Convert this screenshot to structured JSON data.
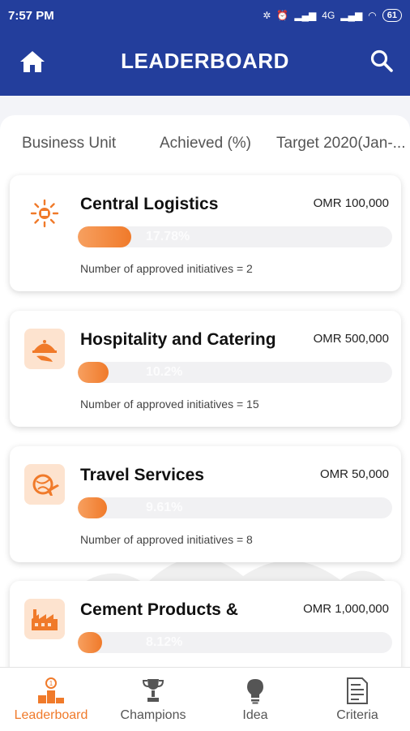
{
  "status": {
    "time": "7:57 PM",
    "network": "4G",
    "battery": "61"
  },
  "header": {
    "title": "LEADERBOARD"
  },
  "columns": [
    "Business Unit",
    "Achieved (%)",
    "Target 2020(Jan-..."
  ],
  "units": [
    {
      "name": "Central Logistics",
      "target": "OMR 100,000",
      "achieved_label": "17.78%",
      "achieved_fraction": 0.1778,
      "count_text": "Number of approved initiatives = 2",
      "icon": "logistics-sun-icon"
    },
    {
      "name": "Hospitality and Catering",
      "target": "OMR 500,000",
      "achieved_label": "10.2%",
      "achieved_fraction": 0.102,
      "count_text": "Number of approved initiatives = 15",
      "icon": "serving-cloche-icon"
    },
    {
      "name": "Travel Services",
      "target": "OMR 50,000",
      "achieved_label": "9.61%",
      "achieved_fraction": 0.0961,
      "count_text": "Number of approved initiatives = 8",
      "icon": "globe-plane-icon"
    },
    {
      "name": "Cement Products &",
      "target": "OMR 1,000,000",
      "achieved_label": "8.12%",
      "achieved_fraction": 0.0812,
      "count_text": "",
      "icon": "factory-icon"
    }
  ],
  "nav": [
    {
      "label": "Leaderboard",
      "icon": "podium-icon",
      "active": true
    },
    {
      "label": "Champions",
      "icon": "trophy-icon",
      "active": false
    },
    {
      "label": "Idea",
      "icon": "lightbulb-icon",
      "active": false
    },
    {
      "label": "Criteria",
      "icon": "document-checklist-icon",
      "active": false
    }
  ],
  "colors": {
    "primary": "#233e9c",
    "accent": "#f07a2a",
    "icon_tint": "#fde3cf"
  }
}
